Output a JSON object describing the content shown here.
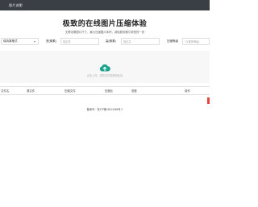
{
  "header": {
    "brand": "图片减肥"
  },
  "hero": {
    "title": "极致的在线图片压缩体验",
    "subtitle": "无需设置图片尺寸，最大压缩图片体积，减轻服务器与带宽的一张"
  },
  "controls": {
    "format_select": "保持原格式",
    "width_label": "宽(像素)",
    "width_placeholder": "固定宽",
    "height_label": "高(像素)",
    "height_placeholder": "固定高",
    "quality_label": "压缩等级",
    "quality_placeholder": "70(推荐等级)"
  },
  "upload": {
    "hint": "点击上传，或将文件拖拽到此处"
  },
  "table": {
    "columns": [
      "文件名",
      "源文件",
      "压缩文件",
      "压缩比",
      "进度",
      "操作"
    ]
  },
  "footer": {
    "icp": "备案号：粤ICP备15013465号-2"
  },
  "colors": {
    "topbar": "#3a3f45",
    "accent": "#1aa38a",
    "alert": "#e8463c"
  }
}
